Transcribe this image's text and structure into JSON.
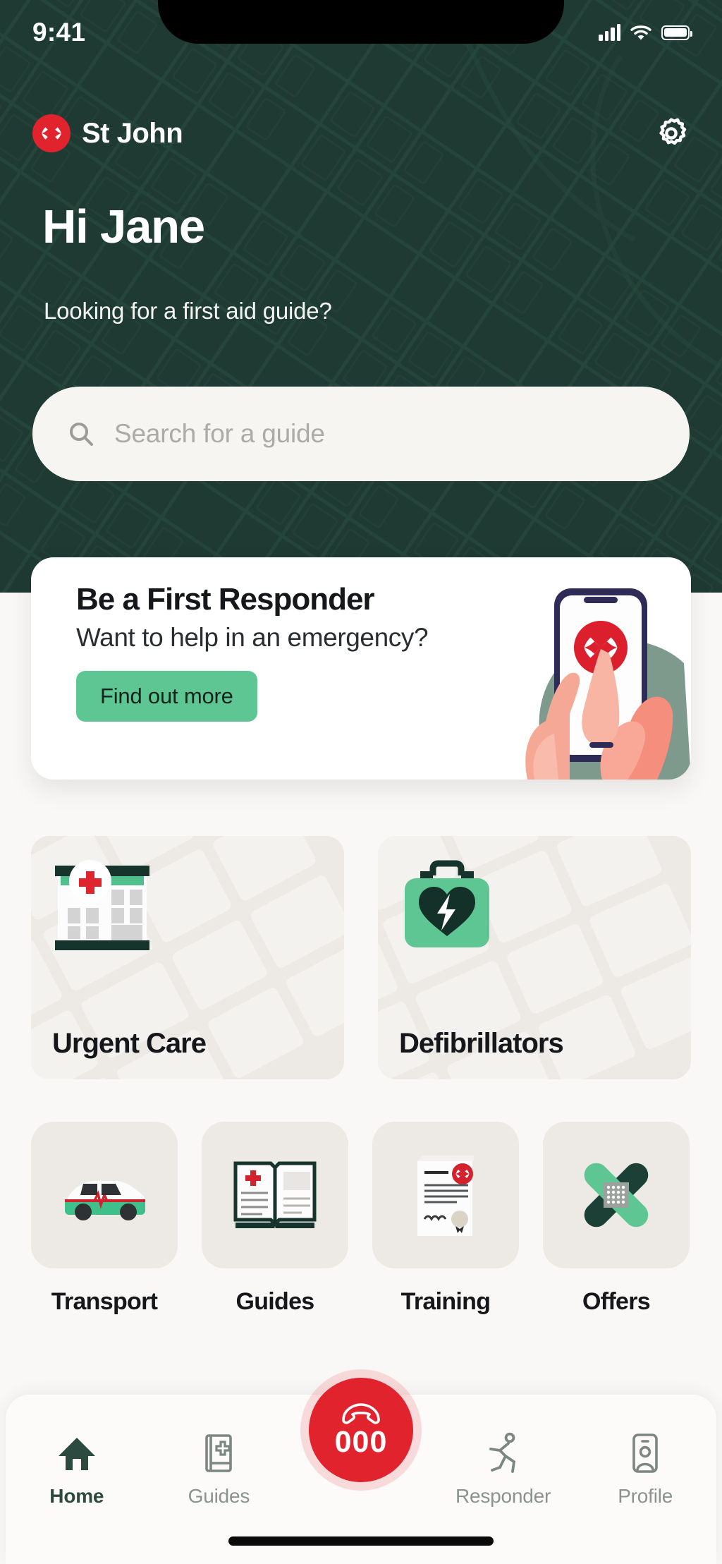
{
  "status_bar": {
    "time": "9:41",
    "icons": [
      "signal-icon",
      "wifi-icon",
      "battery-icon"
    ]
  },
  "header": {
    "brand_name": "St John",
    "brand_badge_icon": "maltese-cross-icon",
    "settings_icon": "gear-icon",
    "greeting": "Hi Jane",
    "subgreeting": "Looking for a first aid guide?",
    "bg_color": "#1E3A32"
  },
  "search": {
    "placeholder": "Search for a guide",
    "icon": "search-icon",
    "value": ""
  },
  "responder_card": {
    "title": "Be a First Responder",
    "subtitle": "Want to help in an emergency?",
    "button_label": "Find out more",
    "button_color": "#5EC693",
    "illustration": "hands-holding-phone-illustration"
  },
  "map_tiles": [
    {
      "label": "Urgent Care",
      "icon": "hospital-building-icon"
    },
    {
      "label": "Defibrillators",
      "icon": "defibrillator-case-icon"
    }
  ],
  "quick_tiles": [
    {
      "label": "Transport",
      "icon": "ambulance-car-icon"
    },
    {
      "label": "Guides",
      "icon": "open-book-icon"
    },
    {
      "label": "Training",
      "icon": "certificate-icon"
    },
    {
      "label": "Offers",
      "icon": "crossed-plasters-icon"
    }
  ],
  "bottom_nav": {
    "items": [
      {
        "label": "Home",
        "icon": "home-icon",
        "active": true
      },
      {
        "label": "Guides",
        "icon": "book-plus-icon",
        "active": false
      },
      {
        "label": "Responder",
        "icon": "running-person-icon",
        "active": false
      },
      {
        "label": "Profile",
        "icon": "id-card-person-icon",
        "active": false
      }
    ],
    "emergency_button": {
      "number": "000",
      "icon": "phone-handset-icon",
      "color": "#E1232E"
    }
  }
}
